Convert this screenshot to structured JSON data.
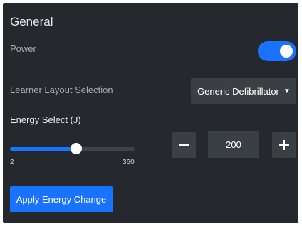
{
  "panel": {
    "title": "General"
  },
  "power": {
    "label": "Power",
    "on": true
  },
  "layout_selection": {
    "label": "Learner Layout Selection",
    "selected": "Generic Defibrillator",
    "caret_icon": "caret-down-icon"
  },
  "energy": {
    "label": "Energy Select (J)",
    "min_label": "2",
    "max_label": "360",
    "slider_fraction": 0.53,
    "value": "200",
    "decrease_icon": "minus-icon",
    "increase_icon": "plus-icon",
    "apply_label": "Apply Energy Change"
  },
  "colors": {
    "panel_bg": "#25292d",
    "accent": "#1a73ff",
    "control_bg": "#3a3f44"
  }
}
